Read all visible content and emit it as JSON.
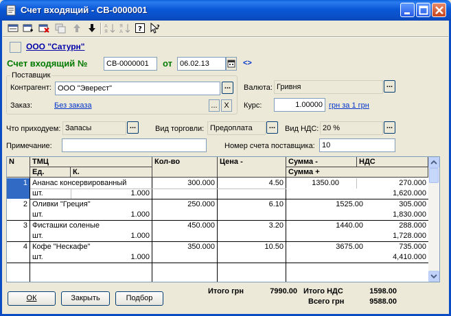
{
  "window": {
    "title": "Счет входящий - СВ-0000001"
  },
  "toolbar": {
    "icons": [
      "new-doc-icon",
      "add-row-icon",
      "delete-row-icon",
      "copy-row-icon",
      "move-up-icon",
      "move-down-icon",
      "sort-asc-icon",
      "sort-desc-icon",
      "help-icon",
      "whats-this-icon"
    ]
  },
  "header": {
    "org_link": "ООО \"Сатурн\"",
    "doc_label": "Счет входящий №",
    "doc_number": "СВ-0000001",
    "date_label": "от",
    "date_value": "06.02.13",
    "history_arrows": "<>"
  },
  "supplier": {
    "group_title": "Поставщик",
    "counterparty_label": "Контрагент:",
    "counterparty_value": "ООО \"Эверест\"",
    "order_label": "Заказ:",
    "order_link": "Без заказа",
    "clear_btn": "X"
  },
  "currency": {
    "label": "Валюта:",
    "value": "Гривня",
    "rate_label": "Курс:",
    "rate_value": "1.00000",
    "rate_link": "грн за 1 грн"
  },
  "fields": {
    "receipt_label": "Что приходуем:",
    "receipt_value": "Запасы",
    "trade_label": "Вид торговли:",
    "trade_value": "Предоплата",
    "vat_label": "Вид НДС:",
    "vat_value": "20 %",
    "note_label": "Примечание:",
    "note_value": "",
    "supplier_invoice_label": "Номер счета поставщика:",
    "supplier_invoice_value": "10"
  },
  "table": {
    "headers": {
      "n": "N",
      "item": "ТМЦ",
      "unit": "Ед.",
      "coef": "К.",
      "qty": "Кол-во",
      "price": "Цена -",
      "sum": "Сумма -",
      "vat": "НДС",
      "sum_plus": "Сумма +"
    },
    "rows": [
      {
        "n": "1",
        "item": "Ананас консервированный",
        "unit": "шт.",
        "coef": "1.000",
        "qty": "300.000",
        "price": "4.50",
        "sum": "1350.00",
        "vat": "270.000",
        "total": "1,620.000"
      },
      {
        "n": "2",
        "item": "Оливки \"Греция\"",
        "unit": "шт.",
        "coef": "1.000",
        "qty": "250.000",
        "price": "6.10",
        "sum": "1525.00",
        "vat": "305.000",
        "total": "1,830.000"
      },
      {
        "n": "3",
        "item": "Фисташки соленые",
        "unit": "шт.",
        "coef": "1.000",
        "qty": "450.000",
        "price": "3.20",
        "sum": "1440.00",
        "vat": "288.000",
        "total": "1,728.000"
      },
      {
        "n": "4",
        "item": "Кофе \"Нескафе\"",
        "unit": "шт.",
        "coef": "1.000",
        "qty": "350.000",
        "price": "10.50",
        "sum": "3675.00",
        "vat": "735.000",
        "total": "4,410.000"
      }
    ]
  },
  "totals": {
    "total_label": "Итого грн",
    "total_value": "7990.00",
    "vat_label": "Итого НДС",
    "vat_value": "1598.00",
    "grand_label": "Всего грн",
    "grand_value": "9588.00"
  },
  "buttons": {
    "ok": "ОК",
    "close": "Закрыть",
    "select": "Подбор"
  },
  "colors": {
    "title_bar": "#0a4cc3",
    "doc_label": "#007a00",
    "link": "#0033cc",
    "selected_row": "#316ac5"
  }
}
